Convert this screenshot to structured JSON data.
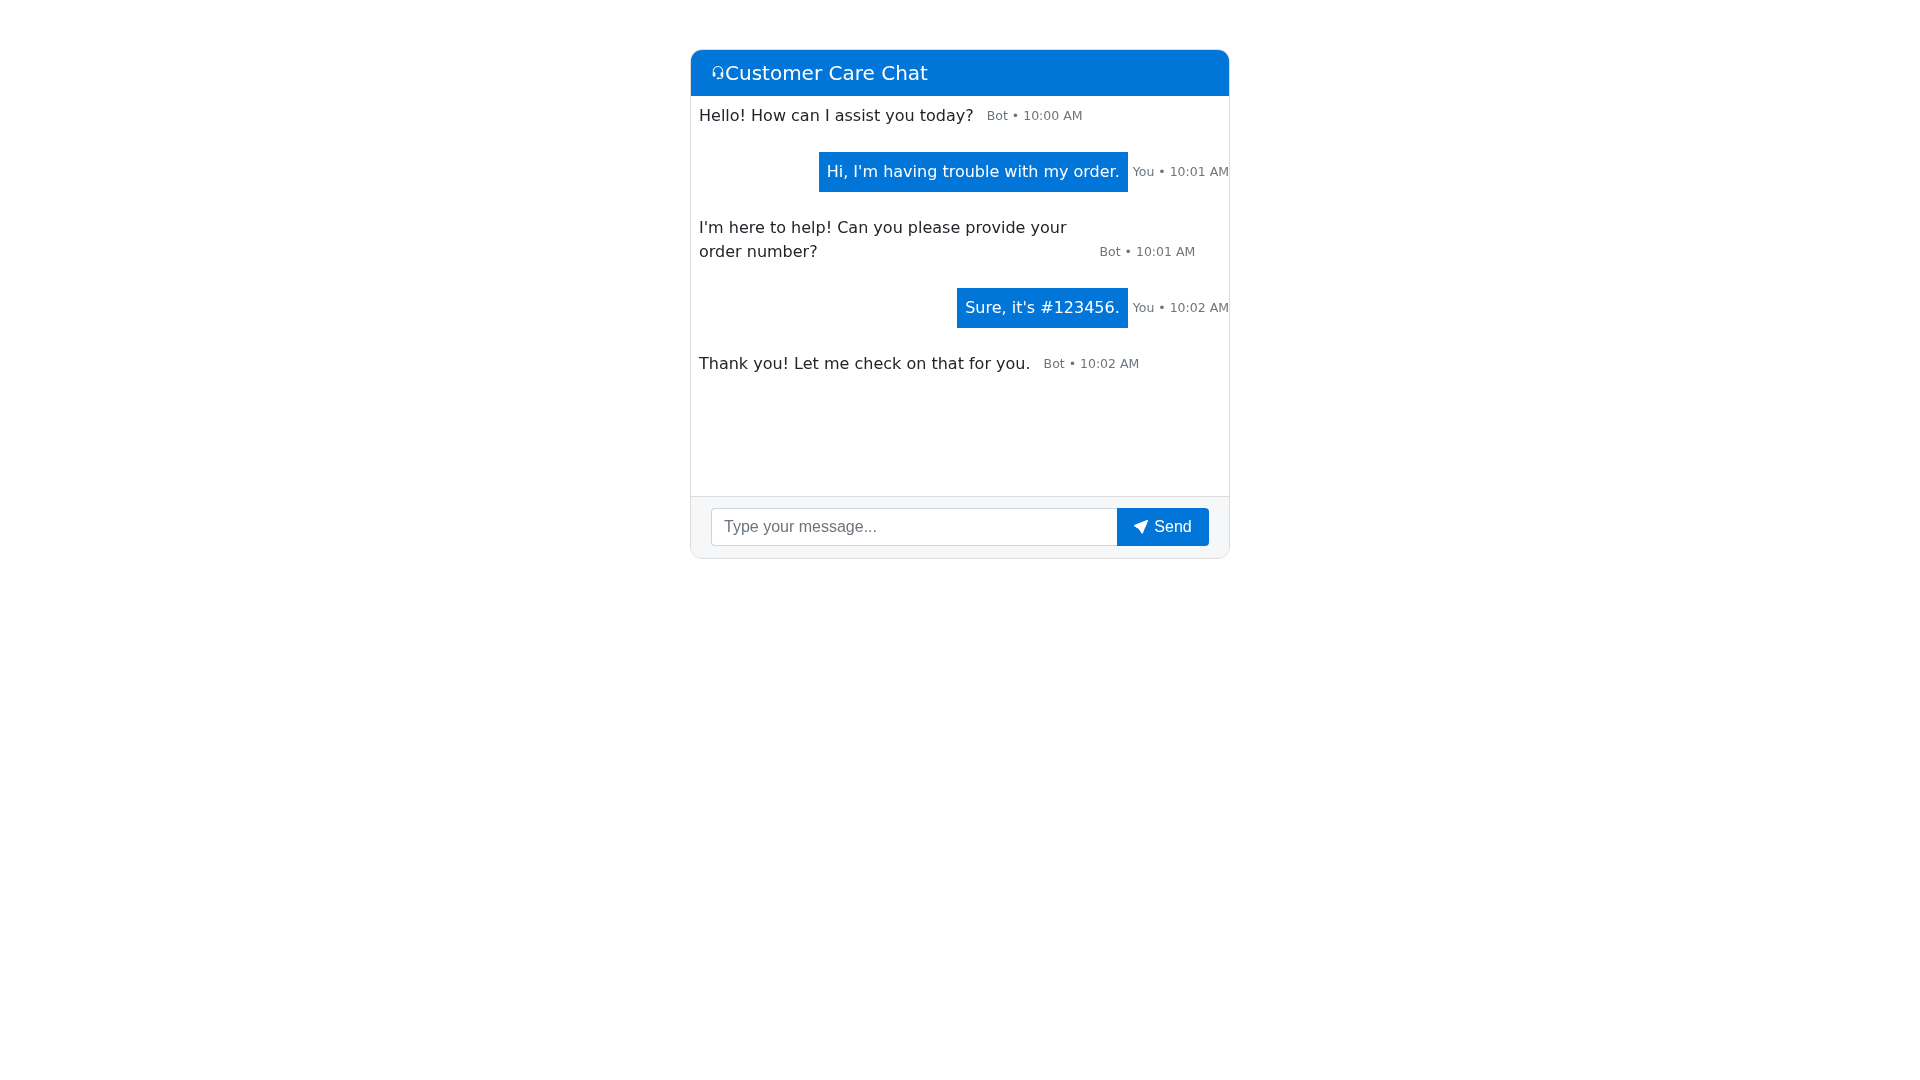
{
  "chat": {
    "title": "Customer Care Chat",
    "messages": [
      {
        "kind": "bot",
        "text": "Hello! How can I assist you today?",
        "meta": "Bot • 10:00 AM"
      },
      {
        "kind": "user",
        "text": "Hi, I'm having trouble with my order.",
        "meta": "You • 10:01 AM"
      },
      {
        "kind": "bot",
        "text": "I'm here to help! Can you please provide your order number?",
        "meta": "Bot • 10:01 AM"
      },
      {
        "kind": "user",
        "text": "Sure, it's #123456.",
        "meta": "You • 10:02 AM"
      },
      {
        "kind": "bot",
        "text": "Thank you! Let me check on that for you.",
        "meta": "Bot • 10:02 AM"
      }
    ],
    "composer": {
      "placeholder": "Type your message...",
      "send_label": "Send"
    }
  }
}
